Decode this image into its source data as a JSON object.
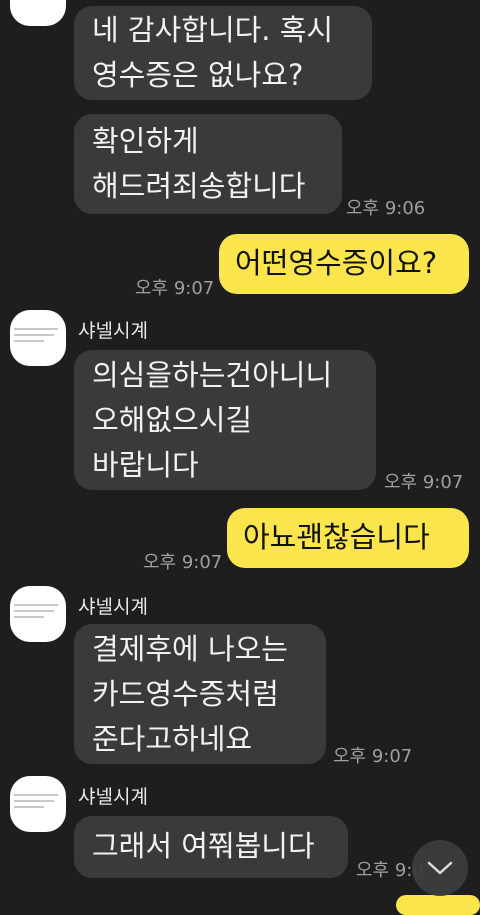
{
  "messages": {
    "m1": {
      "lines": [
        "네 감사합니다. 혹시",
        "영수증은 없나요?"
      ]
    },
    "m2": {
      "lines": [
        "확인하게",
        "해드려죄송합니다"
      ],
      "time": "오후 9:06"
    },
    "m3": {
      "text": "어떤영수증이요?",
      "time": "오후 9:07"
    },
    "m4": {
      "sender": "샤넬시계",
      "lines": [
        "의심을하는건아니니",
        "오해없으시길",
        "바랍니다"
      ],
      "time": "오후 9:07"
    },
    "m5": {
      "text": "아뇨괜찮습니다",
      "time": "오후 9:07"
    },
    "m6": {
      "sender": "샤넬시계",
      "lines": [
        "결제후에 나오는",
        "카드영수증처럼",
        "준다고하네요"
      ],
      "time": "오후 9:07"
    },
    "m7": {
      "sender": "샤넬시계",
      "lines": [
        "그래서 여쭤봅니다"
      ],
      "time": "오후 9:0"
    }
  },
  "colors": {
    "background": "#1e1e1e",
    "incoming_bubble": "#3a3a3a",
    "outgoing_bubble": "#fbe54d",
    "timestamp": "#9f9f9f"
  },
  "icons": {
    "scroll_down": "chevron-down-icon",
    "avatar": "profile-avatar"
  }
}
